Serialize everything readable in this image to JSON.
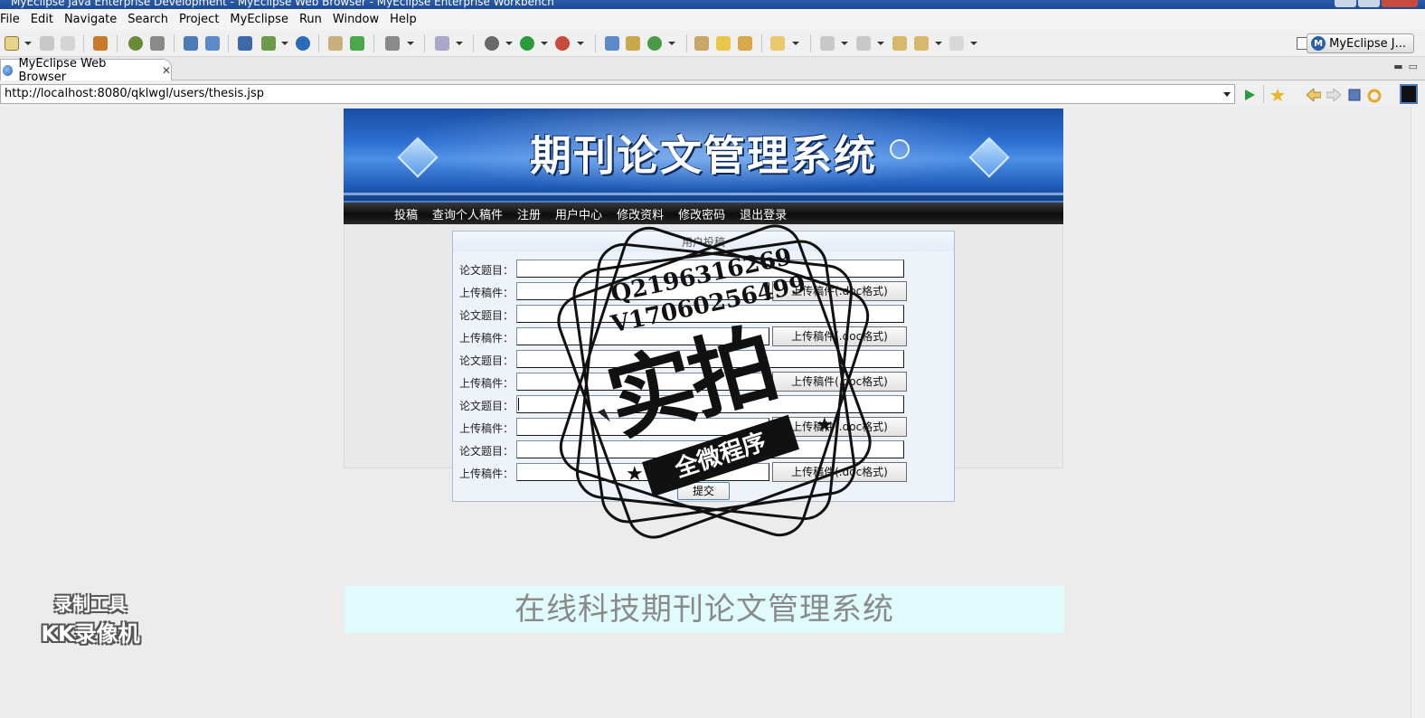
{
  "window": {
    "title": "MyEclipse Java Enterprise Development - MyEclipse Web Browser - MyEclipse Enterprise Workbench"
  },
  "menu": [
    "File",
    "Edit",
    "Navigate",
    "Search",
    "Project",
    "MyEclipse",
    "Run",
    "Window",
    "Help"
  ],
  "perspective": {
    "label": "MyEclipse J..."
  },
  "editor_tab": {
    "label": "MyEclipse Web Browser",
    "close": "✕"
  },
  "address": {
    "url": "http://localhost:8080/qklwgl/users/thesis.jsp"
  },
  "page": {
    "site_title": "期刊论文管理系统",
    "nav": [
      "投稿",
      "查询个人稿件",
      "注册",
      "用户中心",
      "修改资料",
      "修改密码",
      "退出登录"
    ],
    "form": {
      "caption": "用户投稿",
      "title_label": "论文题目：",
      "file_label": "上传稿件：",
      "file_button": "上传稿件(.doc格式)",
      "submit": "提交",
      "rows": 5
    },
    "footer": "在线科技期刊论文管理系统"
  },
  "overlay": {
    "stamp_line1": "Q2196316269",
    "stamp_line2": "V17060256499",
    "stamp_big": "实拍",
    "stamp_ribbon": "全微程序",
    "watermark_line1": "录制工具",
    "watermark_line2": "KK录像机"
  }
}
